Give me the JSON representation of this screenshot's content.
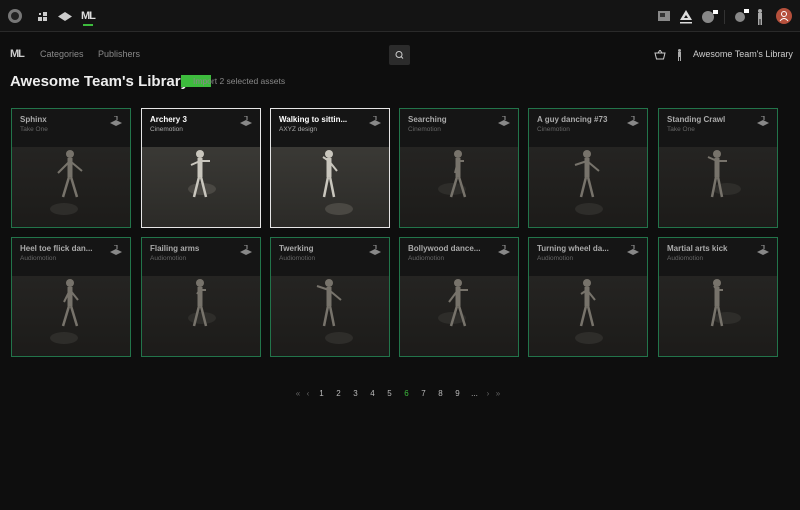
{
  "topbar": {
    "icons": [
      "app-logo-icon",
      "apps-grid-icon",
      "eye-icon",
      "motion-library-icon",
      "screen-icon",
      "triangle-icon",
      "sphere-locked-icon",
      "head-locked-icon",
      "body-icon",
      "user-avatar-icon"
    ],
    "avatar_color": "#b5503c"
  },
  "subnav": {
    "logo": "ML",
    "categories": "Categories",
    "publishers": "Publishers",
    "library_name": "Awesome Team's Library"
  },
  "library": {
    "title": "Awesome Team's Library",
    "import_label": "Import 2 selected assets",
    "accent": "#3dbb3d"
  },
  "assets": [
    {
      "name": "Sphinx",
      "publisher": "Take One",
      "selected": false
    },
    {
      "name": "Archery 3",
      "publisher": "Cinemotion",
      "selected": true
    },
    {
      "name": "Walking to sittin...",
      "publisher": "AXYZ design",
      "selected": true
    },
    {
      "name": "Searching",
      "publisher": "Cinemotion",
      "selected": false
    },
    {
      "name": "A guy dancing #73",
      "publisher": "Cinemotion",
      "selected": false
    },
    {
      "name": "Standing Crawl",
      "publisher": "Take One",
      "selected": false
    },
    {
      "name": "Heel toe flick dan...",
      "publisher": "Audiomotion",
      "selected": false
    },
    {
      "name": "Flailing arms",
      "publisher": "Audiomotion",
      "selected": false
    },
    {
      "name": "Twerking",
      "publisher": "Audiomotion",
      "selected": false
    },
    {
      "name": "Bollywood dance...",
      "publisher": "Audiomotion",
      "selected": false
    },
    {
      "name": "Turning wheel da...",
      "publisher": "Audiomotion",
      "selected": false
    },
    {
      "name": "Martial arts kick",
      "publisher": "Audiomotion",
      "selected": false
    }
  ],
  "pagination": {
    "first": "«",
    "prev": "‹",
    "pages": [
      "1",
      "2",
      "3",
      "4",
      "5",
      "6",
      "7",
      "8",
      "9",
      "..."
    ],
    "current": "6",
    "next": "›",
    "last": "»"
  }
}
